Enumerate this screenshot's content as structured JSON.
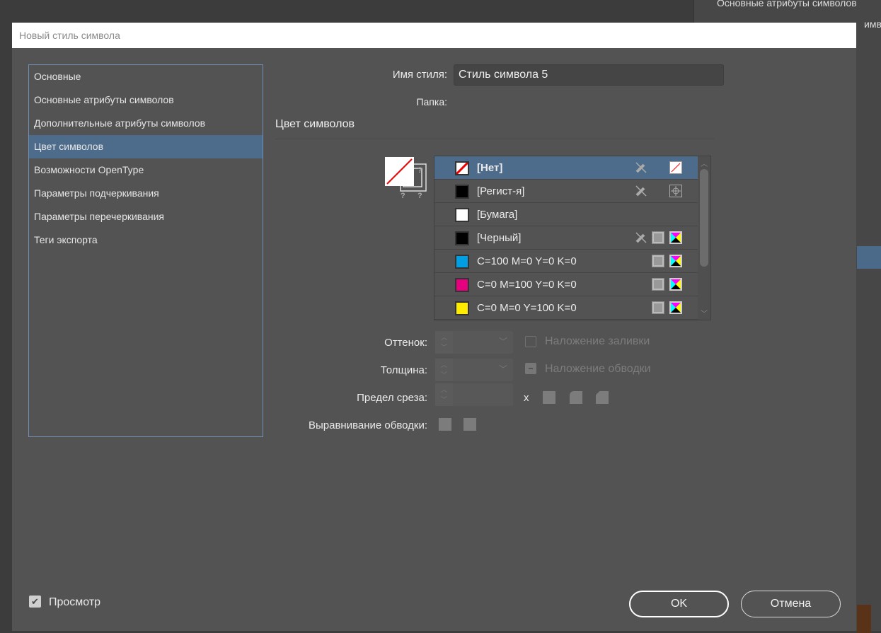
{
  "background": {
    "panel_item_1": "Основные атрибуты символов",
    "panel_item_2_partial": "имво"
  },
  "dialog": {
    "title": "Новый стиль символа"
  },
  "sidebar": {
    "items": [
      {
        "label": "Основные"
      },
      {
        "label": "Основные атрибуты символов"
      },
      {
        "label": "Дополнительные атрибуты символов"
      },
      {
        "label": "Цвет символов"
      },
      {
        "label": "Возможности OpenType"
      },
      {
        "label": "Параметры подчеркивания"
      },
      {
        "label": "Параметры перечеркивания"
      },
      {
        "label": "Теги экспорта"
      }
    ],
    "selected": 3
  },
  "form": {
    "style_name_label": "Имя стиля:",
    "style_name_value": "Стиль символа 5",
    "folder_label": "Папка:",
    "section_title": "Цвет символов"
  },
  "swatches": [
    {
      "name": "[Нет]",
      "color": "#ffffff",
      "icons": [
        "no-edit",
        "none"
      ]
    },
    {
      "name": "[Регист-я]",
      "color": "#000000",
      "icons": [
        "no-edit",
        "registration"
      ]
    },
    {
      "name": "[Бумага]",
      "color": "#ffffff",
      "icons": []
    },
    {
      "name": "[Черный]",
      "color": "#000000",
      "icons": [
        "no-edit",
        "process",
        "cmyk"
      ]
    },
    {
      "name": "C=100 M=0 Y=0 K=0",
      "color": "#009fe3",
      "icons": [
        "process",
        "cmyk"
      ]
    },
    {
      "name": "C=0 M=100 Y=0 K=0",
      "color": "#e6007e",
      "icons": [
        "process",
        "cmyk"
      ]
    },
    {
      "name": "C=0 M=0 Y=100 K=0",
      "color": "#ffed00",
      "icons": [
        "process",
        "cmyk"
      ]
    }
  ],
  "controls": {
    "tint_label": "Оттенок:",
    "weight_label": "Толщина:",
    "miter_label": "Предел среза:",
    "miter_x": "x",
    "align_label": "Выравнивание обводки:",
    "overprint_fill": "Наложение заливки",
    "overprint_stroke": "Наложение обводки"
  },
  "footer": {
    "preview_label": "Просмотр",
    "ok": "OK",
    "cancel": "Отмена"
  }
}
